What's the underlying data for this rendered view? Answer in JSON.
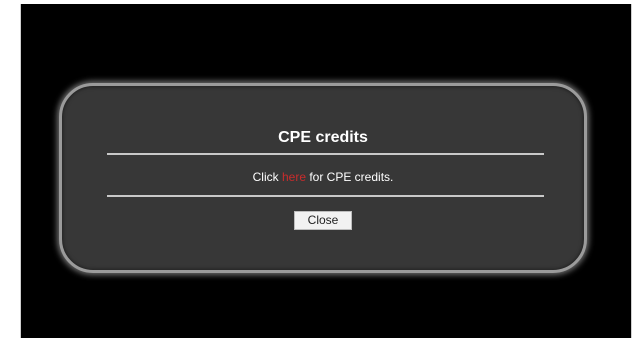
{
  "dialog": {
    "title": "CPE credits",
    "message_prefix": "Click ",
    "link_text": "here",
    "message_suffix": " for CPE credits.",
    "close_label": "Close"
  },
  "colors": {
    "backdrop": "#000000",
    "dialog_background": "#373737",
    "dialog_border": "#9b9b9b",
    "link": "#c92c2c",
    "text": "#ffffff"
  }
}
